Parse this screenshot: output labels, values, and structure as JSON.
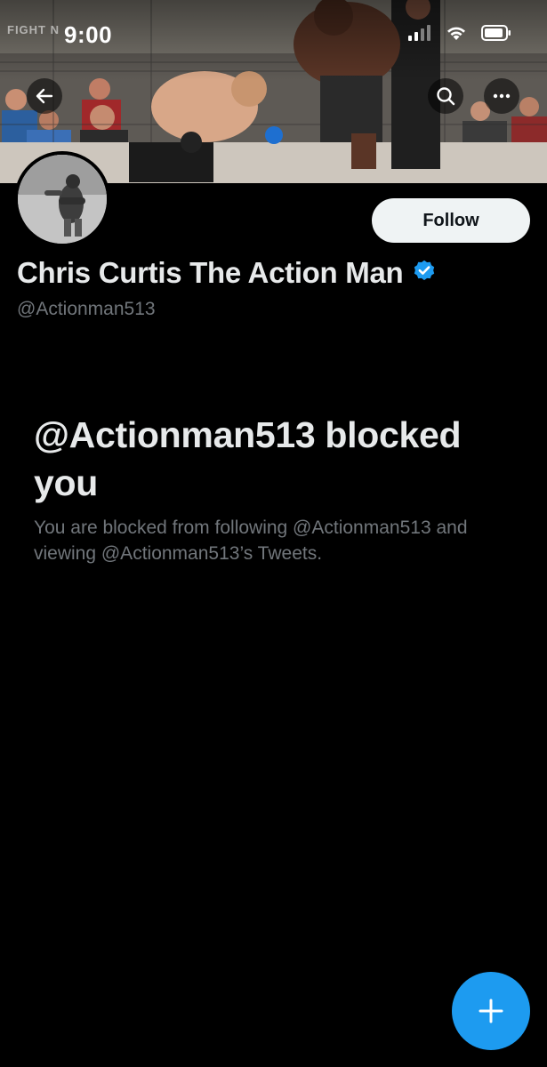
{
  "status_bar": {
    "time": "9:00",
    "watermark": "FIGHT N",
    "icons": [
      "signal-icon",
      "wifi-icon",
      "battery-icon"
    ]
  },
  "banner": {
    "description_icon": "header-photo"
  },
  "nav": {
    "back_icon": "back-arrow-icon",
    "search_icon": "search-icon",
    "more_icon": "more-icon"
  },
  "profile": {
    "display_name": "Chris Curtis The Action Man",
    "handle": "@Actionman513",
    "verified": true,
    "follow_label": "Follow"
  },
  "blocked": {
    "title": "@Actionman513 blocked you",
    "description": "You are blocked from following @Actionman513 and viewing @Actionman513’s Tweets."
  },
  "fab": {
    "icon": "plus-icon"
  },
  "colors": {
    "background": "#000000",
    "text_primary": "#e7e9ea",
    "text_secondary": "#71767b",
    "accent": "#1d9bf0",
    "follow_bg": "#eff3f4"
  }
}
